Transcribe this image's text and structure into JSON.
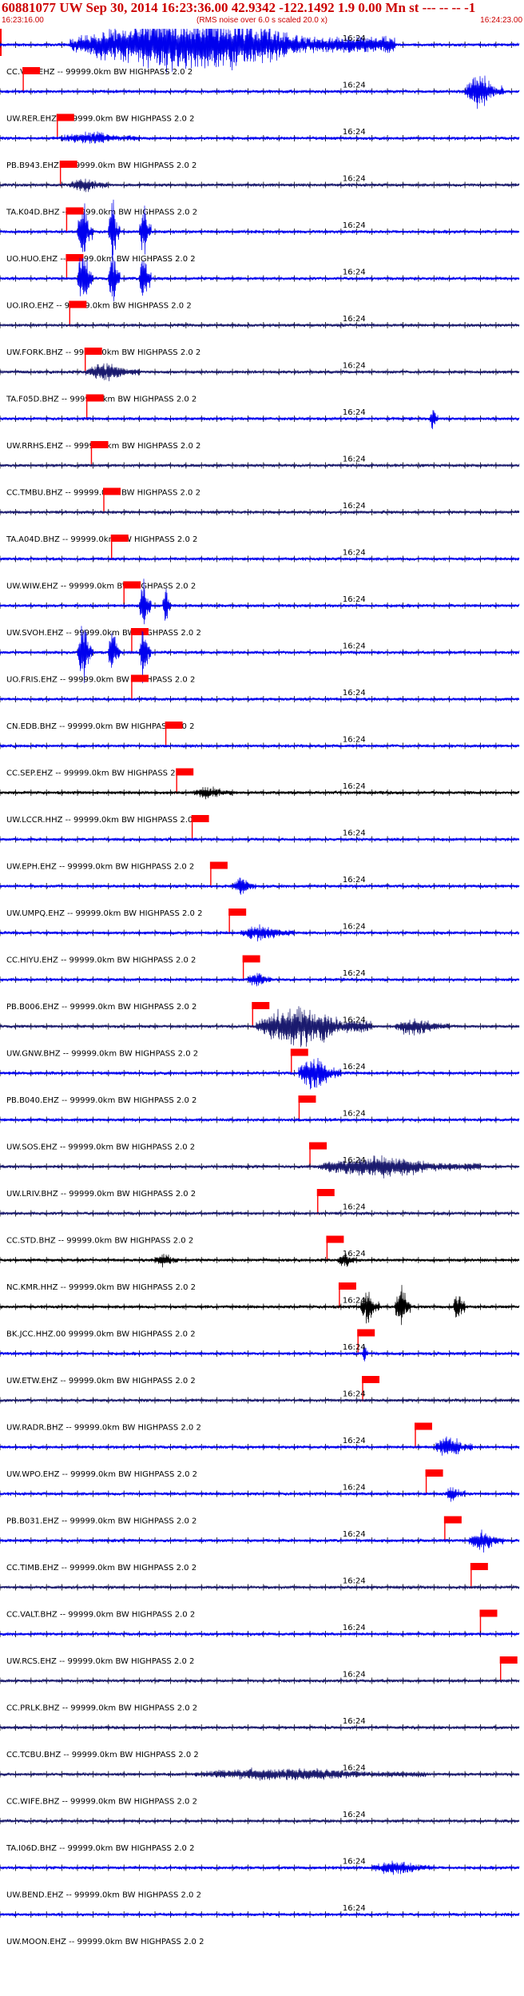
{
  "header": {
    "title": "60881077 UW Sep 30, 2014 16:23:36.00   42.9342 -122.1492  1.9 0.00 Mn st --- -- --  -1",
    "subtitle": "(RMS noise over 6.0 s scaled 20.0 x)",
    "start_time": "16:23:16.00",
    "end_time": "16:24:23.00"
  },
  "colors": {
    "trace_blue": "#0000ee",
    "trace_navy": "#1a1a6e",
    "trace_black": "#000000",
    "pick_red": "#ff0000",
    "header_red": "#cc0000"
  },
  "chart_data": {
    "type": "seismogram",
    "x_units": "seconds after 16:23:16.00",
    "xlim": [
      0,
      67
    ],
    "tick_interval_seconds": 2,
    "minute_label": "16:24",
    "minute_label_at_seconds": 44,
    "origin_marker_seconds": 0,
    "traces": [
      {
        "label": "CC.VIIZ.EHZ -- 99999.0km BW  HIGHPASS  2.0  2",
        "color": "blue",
        "pick": 3,
        "bursts": [
          [
            9,
            51,
            8
          ]
        ]
      },
      {
        "label": "UW.RER.EHZ -- 99999.0km BW  HIGHPASS  2.0  2",
        "color": "blue",
        "pick": 7.4,
        "bursts": [
          [
            60,
            65,
            5
          ]
        ]
      },
      {
        "label": "PB.B943.EHZ -- 99999.0km BW  HIGHPASS  2.0  2",
        "color": "blue",
        "pick": 7.8,
        "bursts": [
          [
            7.8,
            18,
            1.6
          ]
        ]
      },
      {
        "label": "TA.K04D.BHZ -- 99999.0km BW  HIGHPASS  2.0  2",
        "color": "navy",
        "pick": 8.6,
        "bursts": [
          [
            9,
            14,
            1.8
          ]
        ]
      },
      {
        "label": "UO.HUO.EHZ -- 99999.0km BW  HIGHPASS  2.0  2",
        "color": "blue",
        "pick": 8.6,
        "bursts": [
          [
            10,
            12,
            9
          ],
          [
            14,
            15.5,
            9
          ],
          [
            18,
            19.5,
            9
          ]
        ]
      },
      {
        "label": "UO.IRO.EHZ -- 99999.0km BW  HIGHPASS  2.0  2",
        "color": "blue",
        "pick": 9,
        "bursts": [
          [
            10,
            12,
            9
          ],
          [
            14,
            15.5,
            9
          ],
          [
            18,
            19.5,
            9
          ]
        ]
      },
      {
        "label": "UW.FORK.BHZ -- 99999.0km BW  HIGHPASS  2.0  2",
        "color": "navy",
        "pick": 11,
        "bursts": []
      },
      {
        "label": "TA.F05D.BHZ -- 99999.0km BW  HIGHPASS  2.0  2",
        "color": "navy",
        "pick": 11.2,
        "bursts": [
          [
            11,
            18,
            2.5
          ]
        ]
      },
      {
        "label": "UW.RRHS.EHZ -- 99999.0km BW  HIGHPASS  2.0  2",
        "color": "blue",
        "pick": 11.8,
        "bursts": [
          [
            55.5,
            56.5,
            4
          ]
        ]
      },
      {
        "label": "CC.TMBU.BHZ -- 99999.0km BW  HIGHPASS  2.0  2",
        "color": "navy",
        "pick": 13.4,
        "bursts": []
      },
      {
        "label": "TA.A04D.BHZ -- 99999.0km BW  HIGHPASS  2.0  2",
        "color": "navy",
        "pick": 14.4,
        "bursts": []
      },
      {
        "label": "UW.WIW.EHZ -- 99999.0km BW  HIGHPASS  2.0  2",
        "color": "blue",
        "pick": 16,
        "bursts": []
      },
      {
        "label": "UW.SVOH.EHZ -- 99999.0km BW  HIGHPASS  2.0  2",
        "color": "blue",
        "pick": 17,
        "bursts": [
          [
            18,
            19.5,
            8
          ],
          [
            21,
            22,
            6
          ]
        ]
      },
      {
        "label": "UO.FRIS.EHZ -- 99999.0km BW  HIGHPASS  2.0  2",
        "color": "blue",
        "pick": 17,
        "bursts": [
          [
            10,
            12,
            9
          ],
          [
            14,
            15.5,
            9
          ],
          [
            18,
            19.5,
            9
          ]
        ]
      },
      {
        "label": "CN.EDB.BHZ -- 99999.0km BW  HIGHPASS  2.0  2",
        "color": "blue",
        "pick": 21.4,
        "bursts": []
      },
      {
        "label": "CC.SEP.EHZ -- 99999.0km BW  HIGHPASS  2.0  2",
        "color": "blue",
        "pick": 22.8,
        "bursts": []
      },
      {
        "label": "UW.LCCR.HHZ -- 99999.0km BW  HIGHPASS  2.0  2",
        "color": "black",
        "pick": 24.8,
        "bursts": [
          [
            25,
            30,
            1.5
          ]
        ]
      },
      {
        "label": "UW.EPH.EHZ -- 99999.0km BW  HIGHPASS  2.0  2",
        "color": "blue",
        "pick": 27.2,
        "bursts": []
      },
      {
        "label": "UW.UMPQ.EHZ -- 99999.0km BW  HIGHPASS  2.0  2",
        "color": "blue",
        "pick": 29.6,
        "bursts": [
          [
            30,
            33,
            2.5
          ]
        ]
      },
      {
        "label": "CC.HIYU.EHZ -- 99999.0km BW  HIGHPASS  2.0  2",
        "color": "blue",
        "pick": 31.4,
        "bursts": [
          [
            31,
            38,
            2
          ]
        ]
      },
      {
        "label": "PB.B006.EHZ -- 99999.0km BW  HIGHPASS  2.0  2",
        "color": "blue",
        "pick": 32.6,
        "bursts": [
          [
            32,
            35,
            2
          ]
        ]
      },
      {
        "label": "UW.GNW.BHZ -- 99999.0km BW  HIGHPASS  2.0  2",
        "color": "navy",
        "pick": 37.6,
        "bursts": [
          [
            33,
            48,
            6
          ],
          [
            51,
            58,
            2.5
          ]
        ]
      },
      {
        "label": "PB.B040.EHZ -- 99999.0km BW  HIGHPASS  2.0  2",
        "color": "blue",
        "pick": 38.6,
        "bursts": [
          [
            38.5,
            44,
            5
          ]
        ]
      },
      {
        "label": "UW.SOS.EHZ -- 99999.0km BW  HIGHPASS  2.0  2",
        "color": "blue",
        "pick": 40,
        "bursts": []
      },
      {
        "label": "UW.LRIV.BHZ -- 99999.0km BW  HIGHPASS  2.0  2",
        "color": "navy",
        "pick": 41,
        "bursts": [
          [
            41,
            62,
            3
          ]
        ]
      },
      {
        "label": "CC.STD.BHZ -- 99999.0km BW  HIGHPASS  2.0  2",
        "color": "navy",
        "pick": 42.2,
        "bursts": []
      },
      {
        "label": "NC.KMR.HHZ -- 99999.0km BW  HIGHPASS  2.0  2",
        "color": "black",
        "pick": 43.8,
        "bursts": [
          [
            20,
            23,
            1.8
          ],
          [
            43.5,
            46,
            2
          ]
        ]
      },
      {
        "label": "BK.JCC.HHZ.00 99999.0km BW  HIGHPASS  2.0  2",
        "color": "black",
        "pick": 46.2,
        "bursts": [
          [
            46.5,
            49,
            5
          ],
          [
            51,
            53,
            7
          ],
          [
            58.5,
            60,
            5
          ]
        ]
      },
      {
        "label": "UW.ETW.EHZ -- 99999.0km BW  HIGHPASS  2.0  2",
        "color": "blue",
        "pick": 46.8,
        "bursts": [
          [
            46.8,
            47.5,
            3.5
          ]
        ]
      },
      {
        "label": "UW.RADR.BHZ -- 99999.0km BW  HIGHPASS  2.0  2",
        "color": "navy",
        "pick": 53.6,
        "bursts": []
      },
      {
        "label": "UW.WPO.EHZ -- 99999.0km BW  HIGHPASS  2.0  2",
        "color": "blue",
        "pick": 55,
        "bursts": [
          [
            56,
            61,
            3
          ]
        ]
      },
      {
        "label": "PB.B031.EHZ -- 99999.0km BW  HIGHPASS  2.0  2",
        "color": "blue",
        "pick": 57.4,
        "bursts": [
          [
            57.5,
            60,
            2
          ]
        ]
      },
      {
        "label": "CC.TIMB.EHZ -- 99999.0km BW  HIGHPASS  2.0  2",
        "color": "blue",
        "pick": 60.8,
        "bursts": [
          [
            60.5,
            65,
            3
          ]
        ]
      },
      {
        "label": "CC.VALT.BHZ -- 99999.0km BW  HIGHPASS  2.0  2",
        "color": "navy",
        "pick": 62,
        "bursts": []
      },
      {
        "label": "UW.RCS.EHZ -- 99999.0km BW  HIGHPASS  2.0  2",
        "color": "blue",
        "pick": 64.6,
        "bursts": []
      },
      {
        "label": "CC.PRLK.BHZ -- 99999.0km BW  HIGHPASS  2.0  2",
        "color": "navy",
        "pick": null,
        "bursts": []
      },
      {
        "label": "CC.TCBU.BHZ -- 99999.0km BW  HIGHPASS  2.0  2",
        "color": "navy",
        "pick": null,
        "bursts": []
      },
      {
        "label": "CC.WIFE.BHZ -- 99999.0km BW  HIGHPASS  2.0  2",
        "color": "navy",
        "pick": null,
        "bursts": [
          [
            25,
            55,
            1.5
          ]
        ]
      },
      {
        "label": "TA.I06D.BHZ -- 99999.0km BW  HIGHPASS  2.0  2",
        "color": "navy",
        "pick": null,
        "bursts": []
      },
      {
        "label": "UW.BEND.EHZ -- 99999.0km BW  HIGHPASS  2.0  2",
        "color": "blue",
        "pick": null,
        "bursts": [
          [
            48,
            56,
            1.8
          ]
        ]
      },
      {
        "label": "UW.MOON.EHZ -- 99999.0km BW  HIGHPASS  2.0  2",
        "color": "blue",
        "pick": null,
        "bursts": []
      }
    ]
  }
}
